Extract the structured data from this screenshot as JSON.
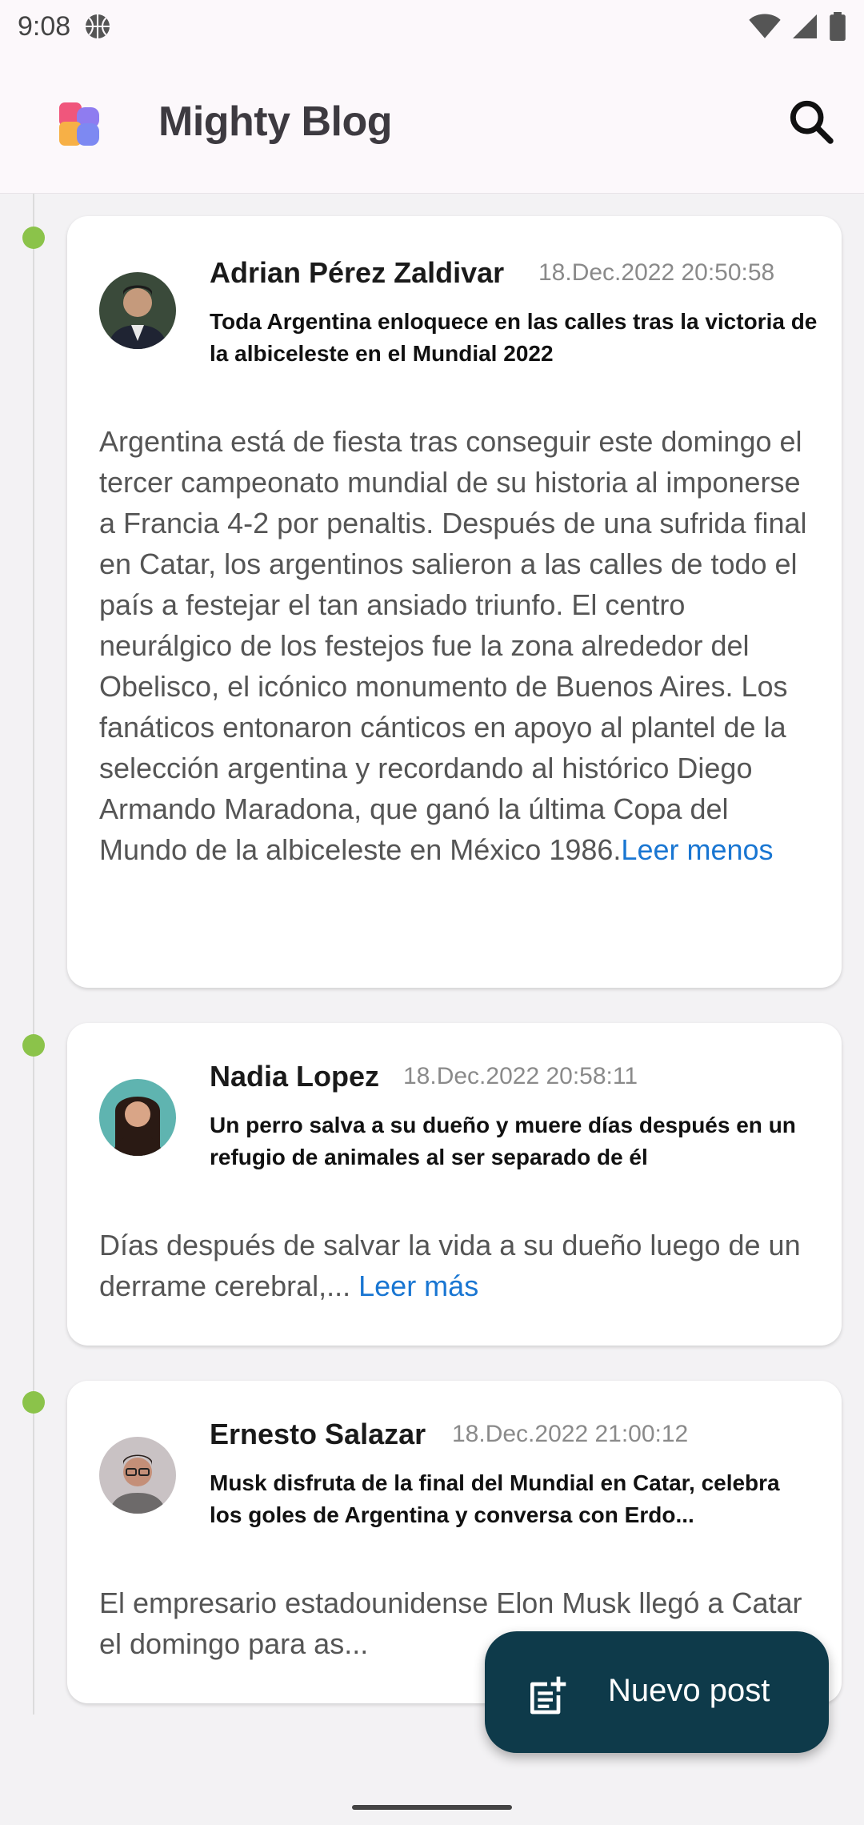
{
  "status_bar": {
    "time": "9:08"
  },
  "app_bar": {
    "title": "Mighty Blog"
  },
  "posts": [
    {
      "author": "Adrian Pérez Zaldivar",
      "date": "18.Dec.2022 20:50:58",
      "title": "Toda Argentina enloquece en las calles tras la victoria de la albiceleste en el Mundial 2022",
      "body": "Argentina está de fiesta tras conseguir este domingo el tercer campeonato mundial de su historia al imponerse a Francia 4-2 por penaltis. Después de una sufrida final en Catar, los argentinos salieron a las calles de todo el país a festejar el tan ansiado triunfo. El centro neurálgico de los festejos fue la zona alrededor del Obelisco, el icónico monumento de Buenos Aires. Los fanáticos entonaron cánticos en apoyo al plantel de la selección argentina y recordando al histórico Diego Armando Maradona, que ganó la última Copa del Mundo de la albiceleste en México 1986.",
      "link": "Leer menos"
    },
    {
      "author": "Nadia Lopez",
      "date": "18.Dec.2022 20:58:11",
      "title": "Un perro salva a su dueño y muere días después en un refugio de animales al ser separado de él",
      "body": "Días después de salvar la vida a su dueño luego de un derrame cerebral,... ",
      "link": "Leer más"
    },
    {
      "author": "Ernesto Salazar",
      "date": "18.Dec.2022 21:00:12",
      "title": "Musk disfruta de la final del Mundial en Catar, celebra los goles de Argentina y conversa con Erdo...",
      "body": "El empresario estadounidense Elon Musk llegó a Catar el domingo para as...",
      "link": ""
    }
  ],
  "fab": {
    "label": "Nuevo post"
  },
  "colors": {
    "timeline_dot": "#8bc34a",
    "link": "#1976d2",
    "fab_bg": "#0e3a4a"
  },
  "icons": {
    "status_left": "basketball-icon",
    "status_right": [
      "wifi-icon",
      "signal-icon",
      "battery-icon"
    ],
    "search": "search-icon",
    "fab": "post-add-icon"
  }
}
